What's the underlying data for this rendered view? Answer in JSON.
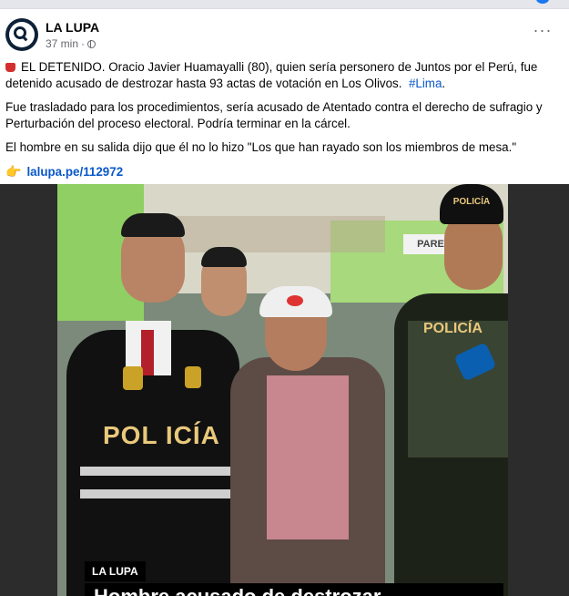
{
  "post": {
    "page_name": "LA LUPA",
    "time": "37 min",
    "separator": "·",
    "more_icon": "···",
    "paragraphs": {
      "p1_text": "EL DETENIDO. Oracio Javier Huamayalli (80), quien sería personero de Juntos por el Perú, fue detenido acusado de destrozar hasta 93 actas de votación en Los Olivos.",
      "p1_hashtag": "#Lima",
      "p1_end": ".",
      "p2": "Fue trasladado para los procedimientos, sería acusado de Atentado contra el derecho de sufragio y Perturbación del proceso electoral. Podría terminar en la cárcel.",
      "p3": "El hombre en su salida dijo que él no lo hizo \"Los que han rayado son los miembros de mesa.\""
    },
    "link": "lalupa.pe/112972",
    "icons": {
      "avatar": "la-lupa-logo",
      "privacy": "globe-icon",
      "flag": "red-flag-icon",
      "hand": "pointing-hand-icon"
    },
    "colors": {
      "link": "#0a58ca",
      "meta": "#65676b",
      "flag": "#d32f2f"
    }
  },
  "video": {
    "vest_label_left": "POL ICÍA",
    "vest_label_right": "POLICÍA",
    "helmet_text": "POLICÍA",
    "wall_sign": "PARE",
    "ticker_tag": "LA LUPA",
    "headline": "Hombre acusado de destrozar"
  }
}
